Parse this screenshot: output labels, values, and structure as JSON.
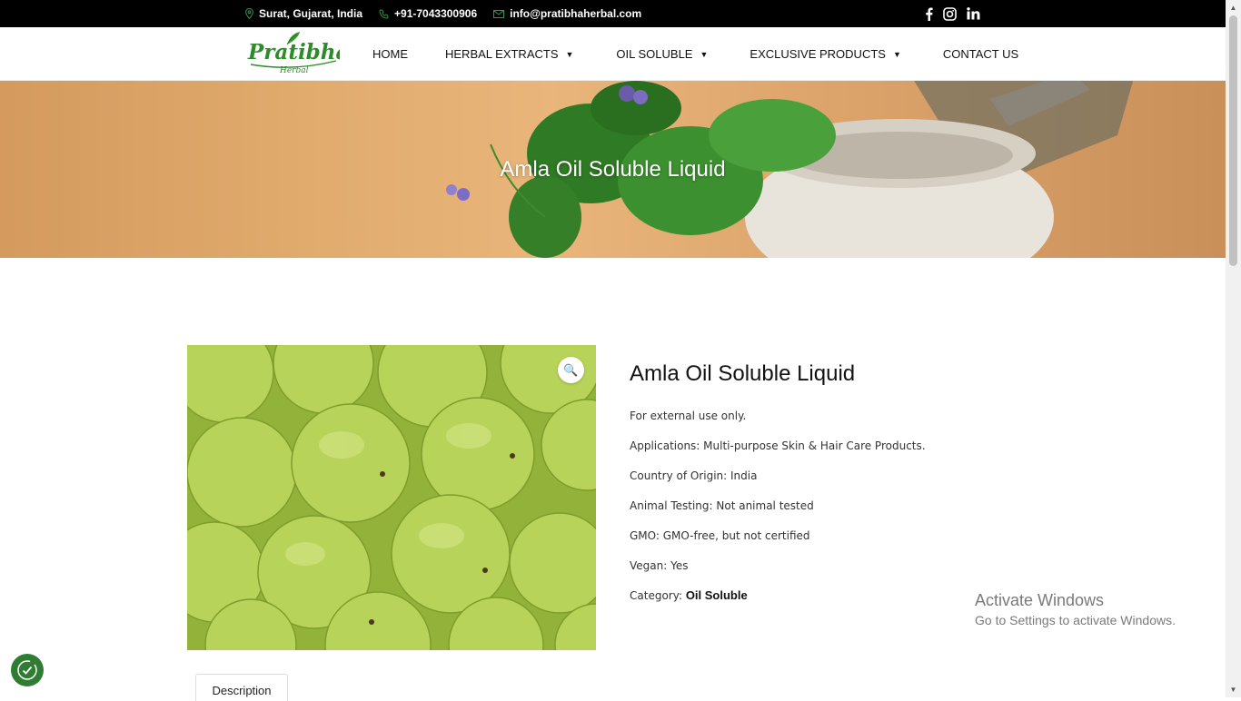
{
  "topbar": {
    "location": "Surat, Gujarat, India",
    "phone": "+91-7043300906",
    "email": "info@pratibhaherbal.com",
    "social": [
      "facebook-icon",
      "instagram-icon",
      "linkedin-icon"
    ]
  },
  "logo": {
    "name": "Pratibha",
    "tagline": "Herbal"
  },
  "nav": {
    "home": "HOME",
    "herbal_extracts": "HERBAL EXTRACTS",
    "oil_soluble": "OIL SOLUBLE",
    "exclusive_products": "EXCLUSIVE PRODUCTS",
    "contact_us": "CONTACT US"
  },
  "banner": {
    "title": "Amla Oil Soluble Liquid"
  },
  "product": {
    "title": "Amla Oil Soluble Liquid",
    "details": [
      "For external use only.",
      "Applications: Multi-purpose Skin & Hair Care Products.",
      "Country of Origin: India",
      "Animal Testing: Not animal tested",
      "GMO: GMO-free, but not certified",
      "Vegan: Yes"
    ],
    "category_label": "Category:",
    "category_value": "Oil Soluble",
    "zoom_icon": "🔍"
  },
  "tabs": {
    "description": "Description"
  },
  "watermark": {
    "line1": "Activate Windows",
    "line2": "Go to Settings to activate Windows."
  },
  "colors": {
    "brand_green": "#2e7d32",
    "topbar": "#000000"
  }
}
